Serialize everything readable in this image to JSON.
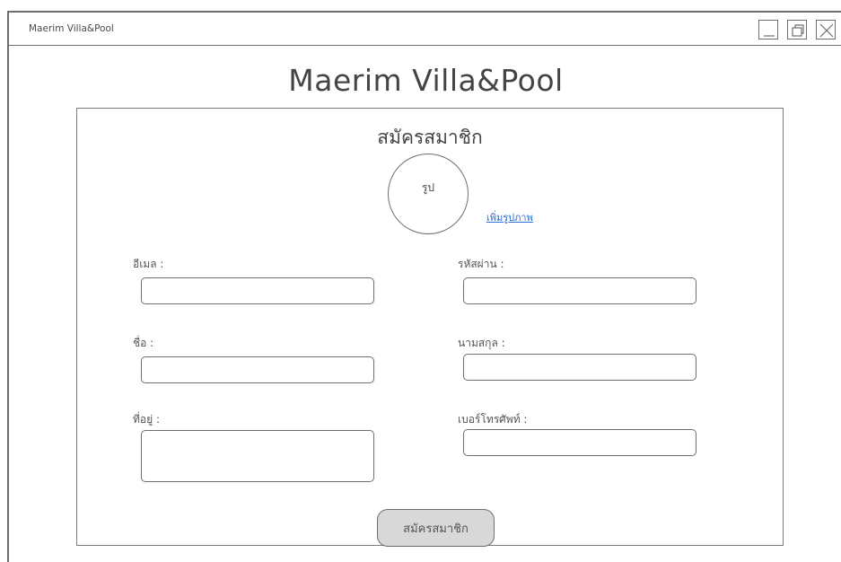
{
  "window": {
    "title": "Maerim Villa&Pool"
  },
  "header": {
    "title": "Maerim Villa&Pool"
  },
  "form": {
    "title": "สมัครสมาชิก",
    "avatar_label": "รูป",
    "add_photo_link": "เพิ่มรูปภาพ",
    "email_label": "อีเมล :",
    "email_value": "",
    "password_label": "รหัสผ่าน :",
    "password_value": "",
    "first_name_label": "ชื่อ :",
    "first_name_value": "",
    "last_name_label": "นามสกุล :",
    "last_name_value": "",
    "address_label": "ที่อยู่ :",
    "address_value": "",
    "phone_label": "เบอร์โทรศัพท์ :",
    "phone_value": "",
    "submit_label": "สมัครสมาชิก"
  }
}
